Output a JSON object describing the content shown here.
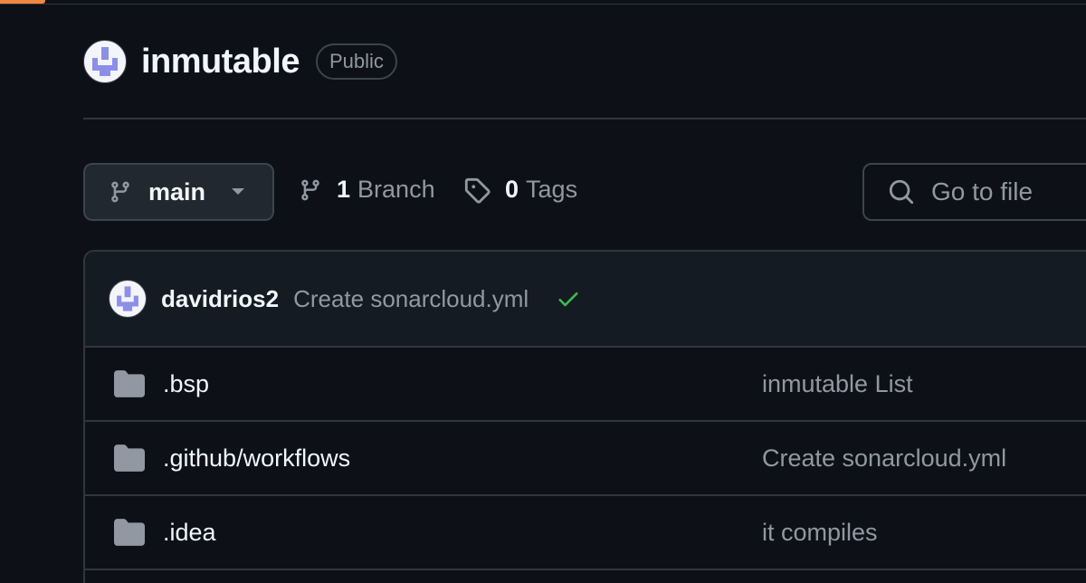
{
  "repo": {
    "name": "inmutable",
    "visibility": "Public"
  },
  "toolbar": {
    "branch": "main",
    "branch_count": "1",
    "branch_label": "Branch",
    "tag_count": "0",
    "tag_label": "Tags",
    "go_to_file_placeholder": "Go to file"
  },
  "latest_commit": {
    "author": "davidrios2",
    "message": "Create sonarcloud.yml",
    "status_icon": "check-icon"
  },
  "files": [
    {
      "name": ".bsp",
      "type": "folder",
      "commit_message": "inmutable List"
    },
    {
      "name": ".github/workflows",
      "type": "folder",
      "commit_message": "Create sonarcloud.yml"
    },
    {
      "name": ".idea",
      "type": "folder",
      "commit_message": "it compiles"
    }
  ],
  "colors": {
    "background": "#0d1117",
    "accent": "#f0883e",
    "success": "#3fb950",
    "avatar_purple": "#8b8fe8"
  }
}
